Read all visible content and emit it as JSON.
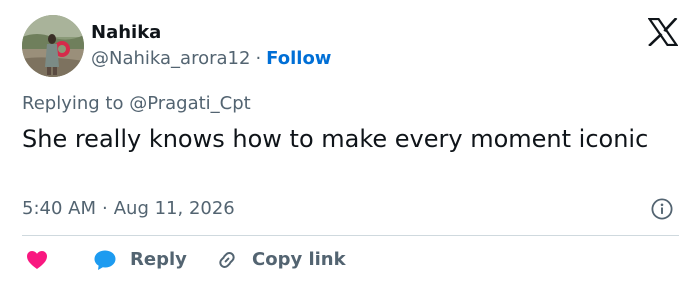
{
  "author": {
    "display_name": "Nahika",
    "handle": "@Nahika_arora12",
    "separator": "·",
    "follow_label": "Follow"
  },
  "brand": {
    "logo_icon": "x-logo-icon"
  },
  "reply_context": {
    "text": "Replying to @Pragati_Cpt"
  },
  "tweet": {
    "text": "She really knows how to make every moment iconic",
    "time": "5:40 AM",
    "separator": "·",
    "date": "Aug 11, 2026"
  },
  "actions": {
    "like_icon": "heart-icon",
    "reply_icon": "speech-bubble-icon",
    "reply_label": "Reply",
    "copy_icon": "link-icon",
    "copy_label": "Copy link"
  },
  "colors": {
    "text_primary": "#0f1419",
    "text_secondary": "#536471",
    "link_blue": "#006fd6",
    "like_pink": "#f91880",
    "reply_blue": "#1d9bf0",
    "divider": "#cfd9de"
  }
}
